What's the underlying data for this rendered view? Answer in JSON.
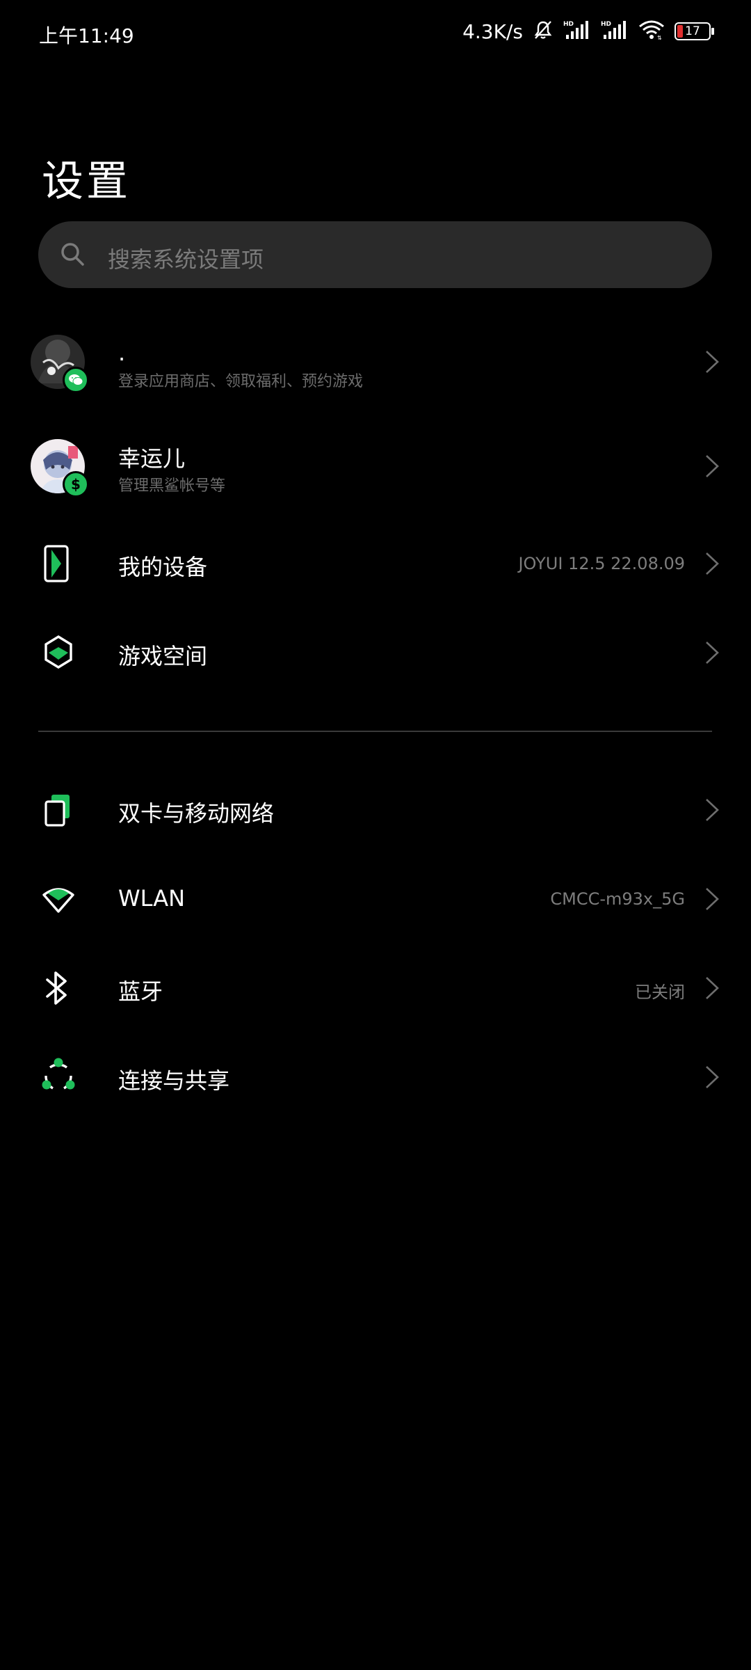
{
  "status_bar": {
    "time": "上午11:49",
    "speed": "4.3K/s",
    "battery": "17"
  },
  "page": {
    "title": "设置"
  },
  "search": {
    "placeholder": "搜索系统设置项"
  },
  "accounts": [
    {
      "title": ".",
      "subtitle": "登录应用商店、领取福利、预约游戏"
    },
    {
      "title": "幸运儿",
      "subtitle": "管理黑鲨帐号等"
    }
  ],
  "device_items": [
    {
      "label": "我的设备",
      "value": "JOYUI 12.5 22.08.09",
      "icon": "phone-device-icon"
    },
    {
      "label": "游戏空间",
      "value": "",
      "icon": "game-space-icon"
    }
  ],
  "network_items": [
    {
      "label": "双卡与移动网络",
      "value": "",
      "icon": "sim-card-icon"
    },
    {
      "label": "WLAN",
      "value": "CMCC-m93x_5G",
      "icon": "wifi-icon"
    },
    {
      "label": "蓝牙",
      "value": "已关闭",
      "icon": "bluetooth-icon"
    },
    {
      "label": "连接与共享",
      "value": "",
      "icon": "share-connection-icon"
    }
  ],
  "colors": {
    "accent": "#1fbe5a",
    "background": "#000000",
    "search_bg": "#2a2a2a",
    "battery_low": "#e03030"
  }
}
